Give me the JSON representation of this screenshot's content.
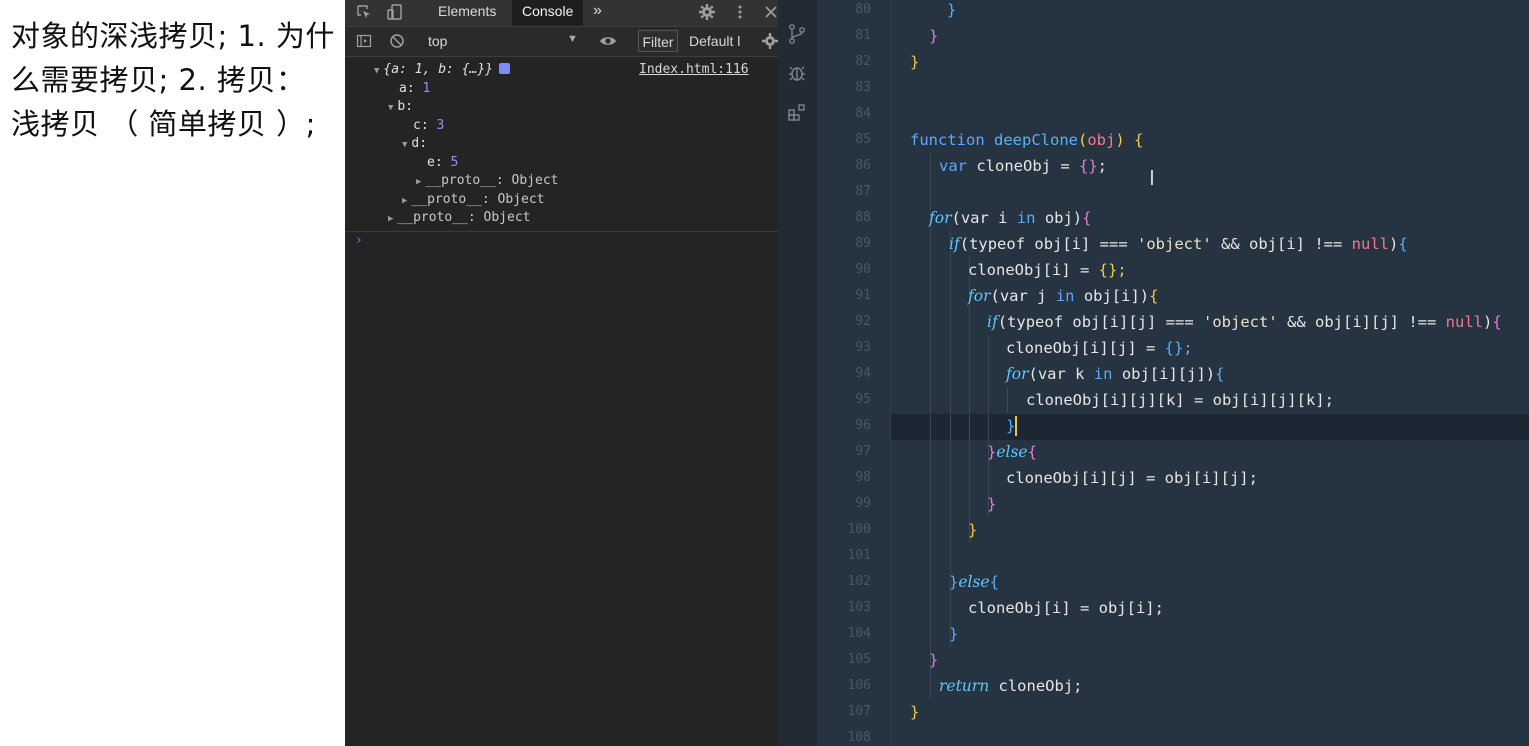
{
  "note": {
    "text": "对象的深浅拷贝; 1. 为什么需要拷贝; 2. 拷贝： 浅拷贝 （ 简单拷贝 ）;"
  },
  "devtools": {
    "tabs": [
      "Elements",
      "Console"
    ],
    "active_tab": "Console",
    "more_tabs_icon": "»",
    "context": "top",
    "filter_label": "Filter",
    "levels_label": "Default l",
    "source_link": "Index.html:116",
    "log": {
      "preview": "{a: 1, b: {…}}",
      "a_key": "a:",
      "a_val": "1",
      "b_key": "b:",
      "c_key": "c:",
      "c_val": "3",
      "d_key": "d:",
      "e_key": "e:",
      "e_val": "5",
      "proto_d": "__proto__: Object",
      "proto_b": "__proto__: Object",
      "proto_root": "__proto__: Object"
    },
    "prompt": "›"
  },
  "editor": {
    "line_numbers": [
      "80",
      "81",
      "82",
      "83",
      "84",
      "85",
      "86",
      "87",
      "88",
      "89",
      "90",
      "91",
      "92",
      "93",
      "94",
      "95",
      "96",
      "97",
      "98",
      "99",
      "100",
      "101",
      "102",
      "103",
      "104",
      "105",
      "106",
      "107",
      "108"
    ],
    "code": {
      "l80": "}",
      "l81": "}",
      "l82": "}",
      "l85_kw": "function",
      "l85_fn": "deepClone",
      "l85_param": "obj",
      "l86_kw": "var",
      "l86_rest": "cloneObj = ",
      "l86_obj": "{}",
      "l88_for": "for",
      "l88_a": "(var i ",
      "l88_in": "in",
      "l88_b": " obj)",
      "l88_brace": "{",
      "l89_if": "if",
      "l89_a": "(typeof obj[i] === ",
      "l89_str": "'object'",
      "l89_b": " && obj[i] !== ",
      "l89_null": "null",
      "l89_c": ")",
      "l89_brace": "{",
      "l90": "cloneObj[i] = ",
      "l90_obj": "{};",
      "l91_for": "for",
      "l91_a": "(var j ",
      "l91_in": "in",
      "l91_b": " obj[i])",
      "l91_brace": "{",
      "l92_if": "if",
      "l92_a": "(typeof obj[i][j] === ",
      "l92_str": "'object'",
      "l92_b": " && obj[i][j] !== ",
      "l92_null": "null",
      "l92_c": ")",
      "l92_brace": "{",
      "l93": "cloneObj[i][j] = ",
      "l93_obj": "{};",
      "l94_for": "for",
      "l94_a": "(var k ",
      "l94_in": "in",
      "l94_b": " obj[i][j])",
      "l94_brace": "{",
      "l95": "cloneObj[i][j][k] = obj[i][j][k];",
      "l96": "}",
      "l97_close": "}",
      "l97_else": "else",
      "l97_brace": "{",
      "l98": "cloneObj[i][j] = obj[i][j];",
      "l99": "}",
      "l100": "}",
      "l102_close": "}",
      "l102_else": "else",
      "l102_brace": "{",
      "l103": "cloneObj[i] = obj[i];",
      "l104": "}",
      "l105": "}",
      "l106_ret": "return",
      "l106_rest": " cloneObj;",
      "l107": "}"
    }
  },
  "colors": {
    "editor_bg": "#263340",
    "devtools_bg": "#242424",
    "keyword": "#5ea6ff",
    "string": "#e9e1c7",
    "null": "#f07890",
    "brace_yellow": "#f3c94a",
    "brace_pink": "#e37bd7"
  },
  "icons": [
    "inspect-icon",
    "device-icon",
    "settings-icon",
    "kebab-icon",
    "close-icon",
    "sidebar-icon",
    "clear-icon",
    "eye-icon",
    "gear-icon",
    "source-control-icon",
    "debug-icon",
    "extensions-icon"
  ]
}
